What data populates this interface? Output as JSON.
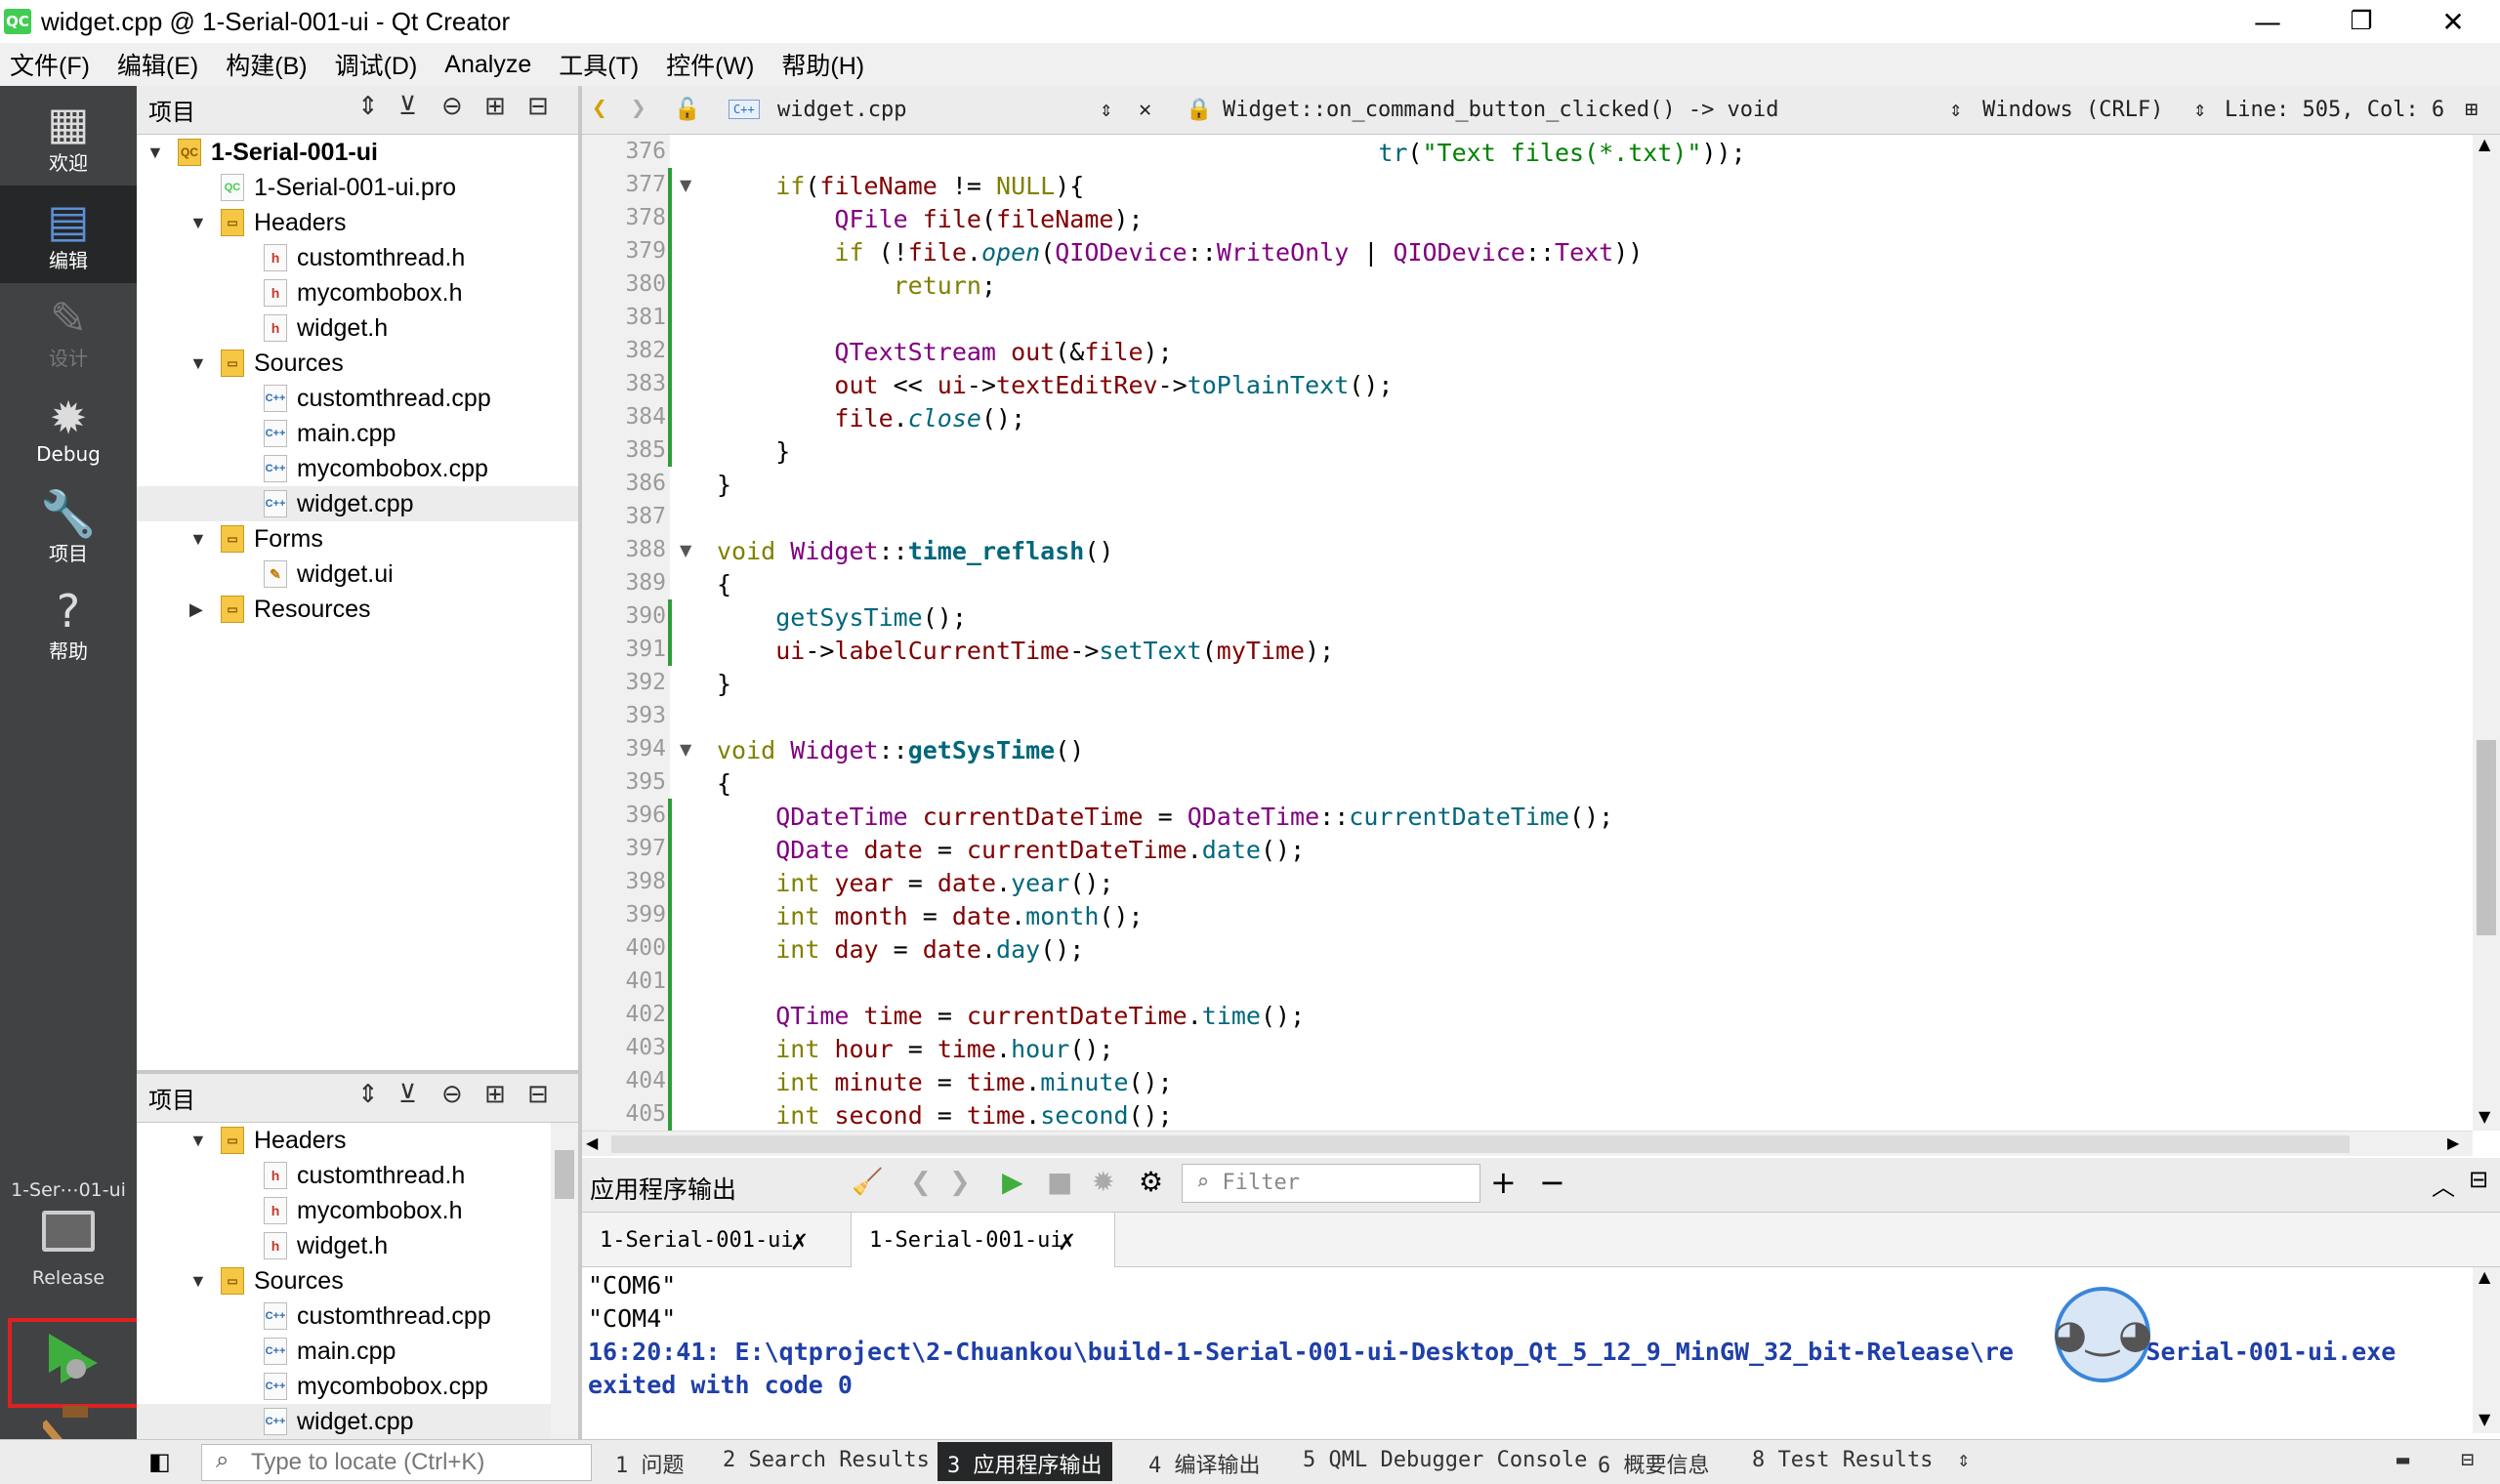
{
  "window": {
    "title": "widget.cpp @ 1-Serial-001-ui - Qt Creator",
    "app_icon": "QC",
    "minimize": "—",
    "restore": "❐",
    "close": "✕"
  },
  "menu": [
    "文件(F)",
    "编辑(E)",
    "构建(B)",
    "调试(D)",
    "Analyze",
    "工具(T)",
    "控件(W)",
    "帮助(H)"
  ],
  "modes": [
    {
      "label": "欢迎",
      "icon": "grid-icon"
    },
    {
      "label": "编辑",
      "icon": "edit-doc-icon"
    },
    {
      "label": "设计",
      "icon": "pencil-icon"
    },
    {
      "label": "Debug",
      "icon": "bug-icon"
    },
    {
      "label": "项目",
      "icon": "wrench-icon"
    },
    {
      "label": "帮助",
      "icon": "help-icon"
    }
  ],
  "kit": {
    "project": "1-Ser⋯01-ui",
    "config": "Release"
  },
  "nav_top": {
    "title": "项目",
    "tree": [
      {
        "label": "1-Serial-001-ui",
        "level": 0,
        "type": "project",
        "expanded": true
      },
      {
        "label": "1-Serial-001-ui.pro",
        "level": 1,
        "type": "pro"
      },
      {
        "label": "Headers",
        "level": 1,
        "type": "folder",
        "expanded": true
      },
      {
        "label": "customthread.h",
        "level": 2,
        "type": "h"
      },
      {
        "label": "mycombobox.h",
        "level": 2,
        "type": "h"
      },
      {
        "label": "widget.h",
        "level": 2,
        "type": "h"
      },
      {
        "label": "Sources",
        "level": 1,
        "type": "folder",
        "expanded": true
      },
      {
        "label": "customthread.cpp",
        "level": 2,
        "type": "cpp"
      },
      {
        "label": "main.cpp",
        "level": 2,
        "type": "cpp"
      },
      {
        "label": "mycombobox.cpp",
        "level": 2,
        "type": "cpp"
      },
      {
        "label": "widget.cpp",
        "level": 2,
        "type": "cpp",
        "selected": true
      },
      {
        "label": "Forms",
        "level": 1,
        "type": "folder",
        "expanded": true
      },
      {
        "label": "widget.ui",
        "level": 2,
        "type": "ui"
      },
      {
        "label": "Resources",
        "level": 1,
        "type": "folder",
        "expanded": false
      }
    ]
  },
  "nav_bottom": {
    "title": "项目",
    "tree": [
      {
        "label": "Headers",
        "level": 1,
        "type": "folder",
        "expanded": true
      },
      {
        "label": "customthread.h",
        "level": 2,
        "type": "h"
      },
      {
        "label": "mycombobox.h",
        "level": 2,
        "type": "h"
      },
      {
        "label": "widget.h",
        "level": 2,
        "type": "h"
      },
      {
        "label": "Sources",
        "level": 1,
        "type": "folder",
        "expanded": true
      },
      {
        "label": "customthread.cpp",
        "level": 2,
        "type": "cpp"
      },
      {
        "label": "main.cpp",
        "level": 2,
        "type": "cpp"
      },
      {
        "label": "mycombobox.cpp",
        "level": 2,
        "type": "cpp"
      },
      {
        "label": "widget.cpp",
        "level": 2,
        "type": "cpp",
        "selected": true
      },
      {
        "label": "Forms",
        "level": 1,
        "type": "folder",
        "expanded": true
      },
      {
        "label": "widget.ui",
        "level": 2,
        "type": "ui"
      },
      {
        "label": "Resources",
        "level": 1,
        "type": "folder",
        "expanded": false
      }
    ]
  },
  "editor_toolbar": {
    "file": "widget.cpp",
    "symbol": "Widget::on_command_button_clicked() -> void",
    "encoding": "Windows (CRLF)",
    "position": "Line: 505, Col: 6"
  },
  "code": [
    {
      "n": "376",
      "h": "                                             <span class=\"fn\">tr</span>(<span class=\"str\">\"Text files(*.txt)\"</span>));"
    },
    {
      "n": "377",
      "fold": true,
      "h": "    <span class=\"kw\">if</span>(<span class=\"fd\">fileName</span> != <span class=\"kw\">NULL</span>){"
    },
    {
      "n": "378",
      "h": "        <span class=\"ty\">QFile</span> <span class=\"fd\">file</span>(<span class=\"fd\">fileName</span>);"
    },
    {
      "n": "379",
      "h": "        <span class=\"kw\">if</span> (!<span class=\"fd\">file</span>.<span class=\"fn\"><i>open</i></span>(<span class=\"ty\">QIODevice</span>::<span class=\"ty\">WriteOnly</span> | <span class=\"ty\">QIODevice</span>::<span class=\"ty\">Text</span>))"
    },
    {
      "n": "380",
      "h": "            <span class=\"kw\">return</span>;"
    },
    {
      "n": "381",
      "h": ""
    },
    {
      "n": "382",
      "h": "        <span class=\"ty\">QTextStream</span> <span class=\"fd\">out</span>(&amp;<span class=\"fd\">file</span>);"
    },
    {
      "n": "383",
      "h": "        <span class=\"fd\">out</span> &lt;&lt; <span class=\"fd\">ui</span>-&gt;<span class=\"fd\">textEditRev</span>-&gt;<span class=\"fn\">toPlainText</span>();"
    },
    {
      "n": "384",
      "h": "        <span class=\"fd\">file</span>.<span class=\"fn\"><i>close</i></span>();"
    },
    {
      "n": "385",
      "h": "    }"
    },
    {
      "n": "386",
      "h": "}"
    },
    {
      "n": "387",
      "h": ""
    },
    {
      "n": "388",
      "fold": true,
      "h": "<span class=\"kw\">void</span> <span class=\"ty\">Widget</span>::<span class=\"bold\">time_reflash</span>()"
    },
    {
      "n": "389",
      "h": "{"
    },
    {
      "n": "390",
      "h": "    <span class=\"fn\">getSysTime</span>();"
    },
    {
      "n": "391",
      "h": "    <span class=\"fd\">ui</span>-&gt;<span class=\"fd\">labelCurrentTime</span>-&gt;<span class=\"fn\">setText</span>(<span class=\"fd\">myTime</span>);"
    },
    {
      "n": "392",
      "h": "}"
    },
    {
      "n": "393",
      "h": ""
    },
    {
      "n": "394",
      "fold": true,
      "h": "<span class=\"kw\">void</span> <span class=\"ty\">Widget</span>::<span class=\"bold\">getSysTime</span>()"
    },
    {
      "n": "395",
      "h": "{"
    },
    {
      "n": "396",
      "h": "    <span class=\"ty\">QDateTime</span> <span class=\"fd\">currentDateTime</span> = <span class=\"ty\">QDateTime</span>::<span class=\"fn\">currentDateTime</span>();"
    },
    {
      "n": "397",
      "h": "    <span class=\"ty\">QDate</span> <span class=\"fd\">date</span> = <span class=\"fd\">currentDateTime</span>.<span class=\"fn\">date</span>();"
    },
    {
      "n": "398",
      "h": "    <span class=\"kw\">int</span> <span class=\"fd\">year</span> = <span class=\"fd\">date</span>.<span class=\"fn\">year</span>();"
    },
    {
      "n": "399",
      "h": "    <span class=\"kw\">int</span> <span class=\"fd\">month</span> = <span class=\"fd\">date</span>.<span class=\"fn\">month</span>();"
    },
    {
      "n": "400",
      "h": "    <span class=\"kw\">int</span> <span class=\"fd\">day</span> = <span class=\"fd\">date</span>.<span class=\"fn\">day</span>();"
    },
    {
      "n": "401",
      "h": ""
    },
    {
      "n": "402",
      "h": "    <span class=\"ty\">QTime</span> <span class=\"fd\">time</span> = <span class=\"fd\">currentDateTime</span>.<span class=\"fn\">time</span>();"
    },
    {
      "n": "403",
      "h": "    <span class=\"kw\">int</span> <span class=\"fd\">hour</span> = <span class=\"fd\">time</span>.<span class=\"fn\">hour</span>();"
    },
    {
      "n": "404",
      "h": "    <span class=\"kw\">int</span> <span class=\"fd\">minute</span> = <span class=\"fd\">time</span>.<span class=\"fn\">minute</span>();"
    },
    {
      "n": "405",
      "h": "    <span class=\"kw\">int</span> <span class=\"fd\">second</span> = <span class=\"fd\">time</span>.<span class=\"fn\">second</span>();"
    }
  ],
  "output_panel": {
    "title": "应用程序输出",
    "filter_placeholder": "Filter",
    "tabs": [
      "1-Serial-001-ui",
      "1-Serial-001-ui"
    ],
    "lines": [
      "\"COM6\"",
      "\"COM4\"",
      "16:20:41: E:\\qtproject\\2-Chuankou\\build-1-Serial-001-ui-Desktop_Qt_5_12_9_MinGW_32_bit-Release\\re      \\1-Serial-001-ui.exe",
      "exited with code 0"
    ]
  },
  "statusbar": {
    "locator_placeholder": "Type to locate (Ctrl+K)",
    "tabs": [
      "1  问题",
      "2  Search Results",
      "3  应用程序输出",
      "4  编译输出",
      "5  QML Debugger Console",
      "6  概要信息",
      "8  Test Results"
    ],
    "active_tab": 2
  }
}
